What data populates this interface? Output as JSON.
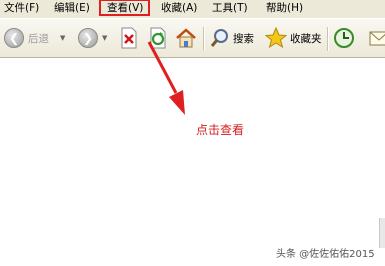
{
  "menubar": {
    "file": "文件(F)",
    "edit": "编辑(E)",
    "view": "查看(V)",
    "favorites": "收藏(A)",
    "tools": "工具(T)",
    "help": "帮助(H)"
  },
  "toolbar": {
    "back_label": "后退",
    "search_label": "搜索",
    "favorites_label": "收藏夹"
  },
  "annotation": {
    "text": "点击查看",
    "color": "#d42020"
  },
  "watermark": "头条 @佐佐佑佑2015"
}
